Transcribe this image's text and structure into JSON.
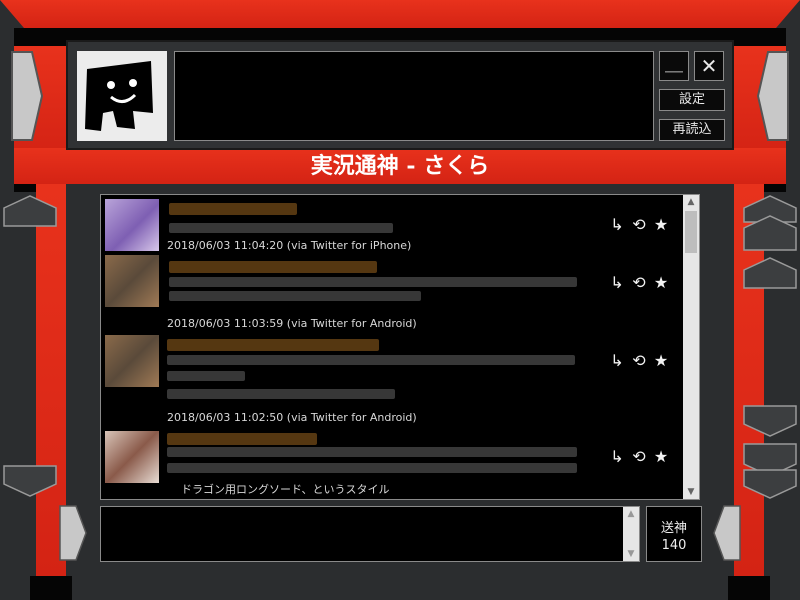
{
  "app": {
    "title": "実況通神 - さくら",
    "colors": {
      "torii_red": "#e0281a",
      "panel_black": "#050505",
      "background": "#2b2d2f"
    }
  },
  "window_controls": {
    "minimize_label": "＿",
    "close_label": "✕",
    "settings_label": "設定",
    "reload_label": "再読込"
  },
  "timeline": {
    "tweets": [
      {
        "timestamp": "2018/06/03 11:04:20 (via Twitter for iPhone)",
        "actions": {
          "reply_icon": "↳",
          "retweet_icon": "⟲",
          "favorite_icon": "★"
        }
      },
      {
        "timestamp": "2018/06/03 11:03:59 (via Twitter for Android)",
        "actions": {
          "reply_icon": "↳",
          "retweet_icon": "⟲",
          "favorite_icon": "★"
        }
      },
      {
        "timestamp": "2018/06/03 11:02:50 (via Twitter for Android)",
        "actions": {
          "reply_icon": "↳",
          "retweet_icon": "⟲",
          "favorite_icon": "★"
        }
      },
      {
        "timestamp": "",
        "partial_text": "ドラゴン用ロングソード、というスタイル",
        "actions": {
          "reply_icon": "↳",
          "retweet_icon": "⟲",
          "favorite_icon": "★"
        }
      }
    ]
  },
  "composer": {
    "value": "",
    "send_label": "送神",
    "remaining": "140"
  }
}
